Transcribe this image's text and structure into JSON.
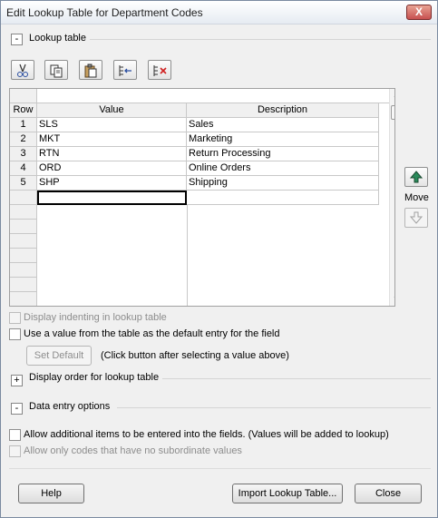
{
  "window": {
    "title": "Edit Lookup Table for Department Codes",
    "close_glyph": "X"
  },
  "sections": {
    "lookup_table": {
      "toggle": "-",
      "label": "Lookup table"
    },
    "display_order": {
      "toggle": "+",
      "label": "Display order for lookup table"
    },
    "data_entry": {
      "toggle": "-",
      "label": "Data entry options"
    }
  },
  "toolbar": [
    {
      "name": "cut-icon"
    },
    {
      "name": "copy-icon"
    },
    {
      "name": "paste-icon"
    },
    {
      "name": "insert-row-icon"
    },
    {
      "name": "delete-row-icon"
    }
  ],
  "table": {
    "headers": {
      "row": "Row",
      "value": "Value",
      "description": "Description"
    },
    "rows": [
      {
        "row": "1",
        "value": "SLS",
        "description": "Sales"
      },
      {
        "row": "2",
        "value": "MKT",
        "description": "Marketing"
      },
      {
        "row": "3",
        "value": "RTN",
        "description": "Return Processing"
      },
      {
        "row": "4",
        "value": "ORD",
        "description": "Online Orders"
      },
      {
        "row": "5",
        "value": "SHP",
        "description": "Shipping"
      }
    ]
  },
  "move": {
    "label": "Move"
  },
  "options": {
    "display_indenting": "Display indenting in lookup table",
    "use_default": "Use a value from the table as the default entry for the field",
    "set_default": "Set Default",
    "set_default_hint": "(Click button after selecting a value above)",
    "allow_additional": "Allow additional items to be entered into the fields. (Values will be added to lookup)",
    "allow_only_codes": "Allow only codes that have no subordinate values"
  },
  "footer": {
    "help": "Help",
    "import": "Import Lookup Table...",
    "close": "Close"
  }
}
